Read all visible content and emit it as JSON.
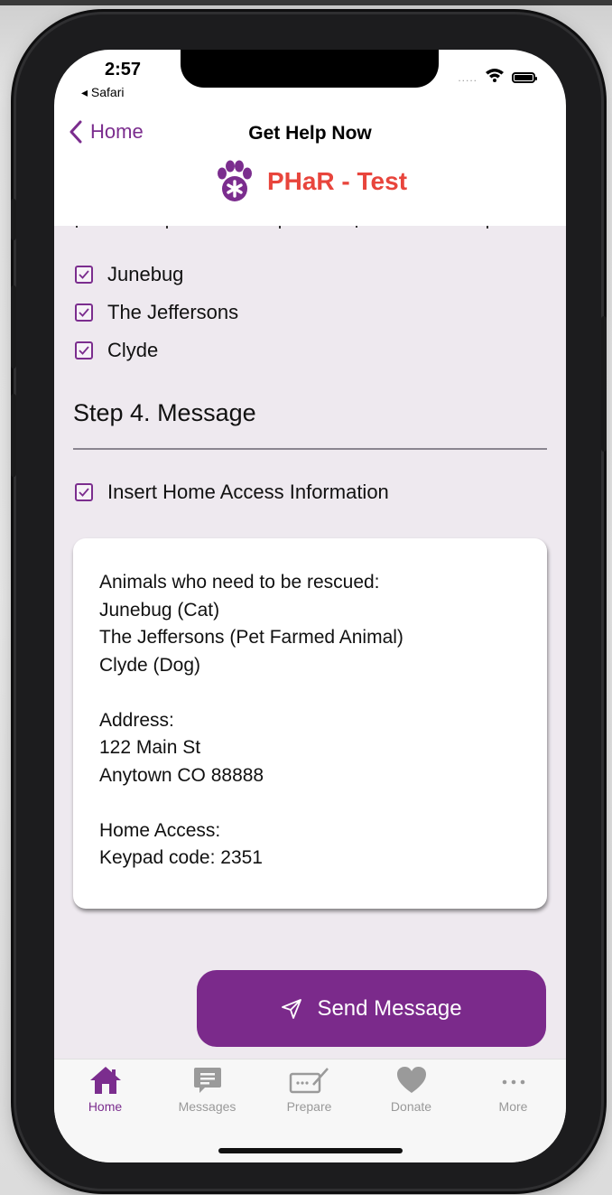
{
  "status_bar": {
    "time": "2:57",
    "back_app": "◂ Safari",
    "signal_dots": "....."
  },
  "nav": {
    "back_label": "Home",
    "title": "Get Help Now",
    "brand_name": "PHaR - Test"
  },
  "animals": [
    {
      "label": "Junebug",
      "checked": true
    },
    {
      "label": "The Jeffersons",
      "checked": true
    },
    {
      "label": "Clyde",
      "checked": true
    }
  ],
  "step4": {
    "title": "Step 4. Message",
    "insert_home_access_label": "Insert Home Access Information",
    "insert_home_access_checked": true
  },
  "message": {
    "lines": [
      "Animals who need to be rescued:",
      "Junebug (Cat)",
      "The Jeffersons (Pet Farmed Animal)",
      "Clyde (Dog)",
      "",
      "Address:",
      "122 Main St",
      "Anytown CO 88888",
      "",
      "Home Access:",
      "Keypad code: 2351"
    ]
  },
  "send_button": {
    "label": "Send Message"
  },
  "tabs": [
    {
      "label": "Home",
      "icon": "home-icon",
      "active": true
    },
    {
      "label": "Messages",
      "icon": "messages-icon",
      "active": false
    },
    {
      "label": "Prepare",
      "icon": "prepare-icon",
      "active": false
    },
    {
      "label": "Donate",
      "icon": "heart-icon",
      "active": false
    },
    {
      "label": "More",
      "icon": "more-icon",
      "active": false
    }
  ],
  "colors": {
    "accent": "#7b2d8e",
    "brand_red": "#e8453c",
    "content_bg": "#eee9ef"
  }
}
